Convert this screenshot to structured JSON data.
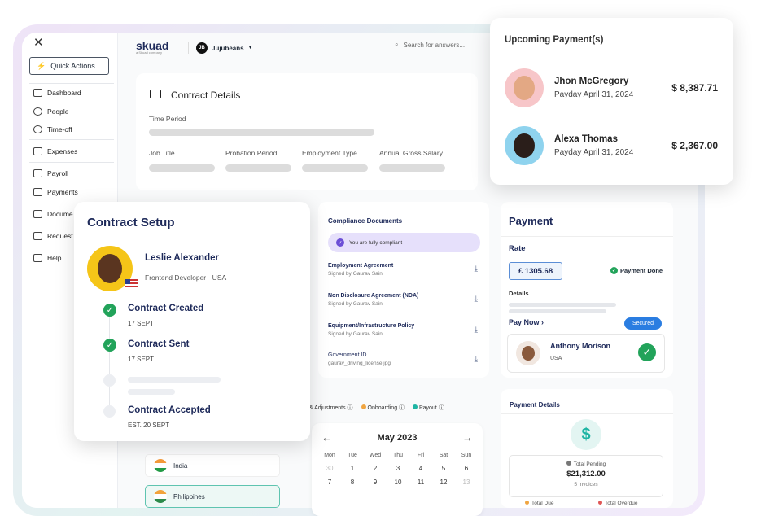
{
  "sidebar": {
    "quick_actions": "Quick Actions",
    "items": [
      {
        "label": "Dashboard",
        "icon": "grid-icon"
      },
      {
        "label": "People",
        "icon": "people-icon"
      },
      {
        "label": "Time-off",
        "icon": "clock-icon"
      },
      {
        "label": "Expenses",
        "icon": "chart-icon"
      },
      {
        "label": "Payroll",
        "icon": "payroll-icon"
      },
      {
        "label": "Payments",
        "icon": "wallet-icon"
      },
      {
        "label": "Docume",
        "icon": "document-icon"
      },
      {
        "label": "Request",
        "icon": "request-icon"
      },
      {
        "label": "Help",
        "icon": "help-icon"
      }
    ]
  },
  "header": {
    "logo": "skuad",
    "logo_sub": "a Skuad company",
    "org_badge": "JB",
    "org_name": "Jujubeans",
    "search_placeholder": "Search for answers..."
  },
  "contract_details": {
    "title": "Contract Details",
    "time_period": "Time Period",
    "fields": [
      "Job Title",
      "Probation Period",
      "Employment Type",
      "Annual Gross Salary"
    ]
  },
  "contract_setup": {
    "title": "Contract Setup",
    "name": "Leslie Alexander",
    "role": "Frontend Developer · USA",
    "steps": [
      {
        "label": "Contract Created",
        "date": "17 SEPT"
      },
      {
        "label": "Contract Sent",
        "date": "17 SEPT"
      },
      {
        "label": "Contract Accepted",
        "date": "EST. 20 SEPT"
      }
    ]
  },
  "compliance": {
    "title": "Compliance Documents",
    "status": "You are fully compliant",
    "docs": [
      {
        "title": "Employment Agreement",
        "sub": "Signed by Gaurav Saini"
      },
      {
        "title": "Non Disclosure Agreement (NDA)",
        "sub": "Signed by Gaurav Saini"
      },
      {
        "title": "Equipment/Infrastructure Policy",
        "sub": "Signed by Gaurav Saini"
      },
      {
        "title": "Government ID",
        "sub": "gaurav_driving_license.jpg"
      }
    ]
  },
  "payment": {
    "title": "Payment",
    "rate_label": "Rate",
    "rate": "£ 1305.68",
    "status": "Payment Done",
    "details_label": "Details",
    "pay_now": "Pay Now",
    "badge": "Secured",
    "person_name": "Anthony Morison",
    "person_country": "USA"
  },
  "payment_details": {
    "title": "Payment Details",
    "pending_label": "Total Pending",
    "pending_amount": "$21,312.00",
    "invoices": "5 Invoices",
    "due_label": "Total Due",
    "overdue_label": "Total Overdue"
  },
  "upcoming": {
    "title": "Upcoming Payment(s)",
    "items": [
      {
        "name": "Jhon McGregory",
        "date": "Payday April 31, 2024",
        "amount": "$ 8,387.71"
      },
      {
        "name": "Alexa Thomas",
        "date": "Payday April 31, 2024",
        "amount": "$ 2,367.00"
      }
    ]
  },
  "legend": {
    "items": [
      "ses & Adjustments",
      "Onboarding",
      "Payout"
    ]
  },
  "calendar": {
    "month": "May 2023",
    "weekdays": [
      "Mon",
      "Tue",
      "Wed",
      "Thu",
      "Fri",
      "Sat",
      "Sun"
    ],
    "days": [
      "30",
      "1",
      "2",
      "3",
      "4",
      "5",
      "6",
      "7",
      "8",
      "9",
      "10",
      "11",
      "12",
      "13"
    ]
  },
  "countries": [
    "India",
    "Philippines"
  ],
  "colors": {
    "brand": "#1e2a5a",
    "success": "#22a35a",
    "accent": "#2a7de1",
    "onboarding": "#f0a541",
    "payout": "#1fb5a4",
    "overdue": "#e05656"
  }
}
